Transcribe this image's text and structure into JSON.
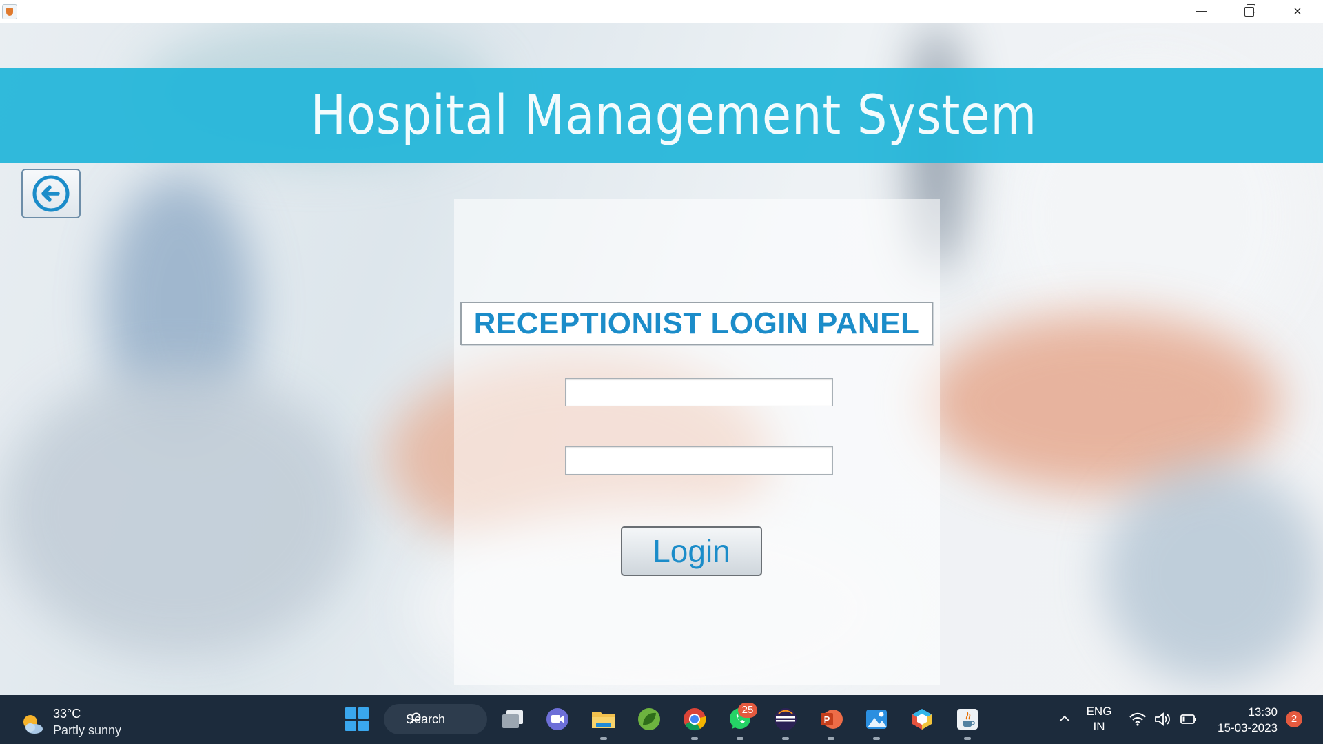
{
  "window": {
    "minimize_glyph": "minimize-icon",
    "maximize_glyph": "restore-icon",
    "close_glyph": "×"
  },
  "header": {
    "title": "Hospital Management System",
    "banner_color": "#26b6d9"
  },
  "login_panel": {
    "title": "RECEPTIONIST LOGIN PANEL",
    "username_value": "",
    "password_value": "",
    "login_label": "Login",
    "accent_color": "#1b8cc9"
  },
  "taskbar": {
    "weather": {
      "temp": "33°C",
      "desc": "Partly sunny",
      "icon": "partly-sunny-icon"
    },
    "search_label": "Search",
    "apps": [
      {
        "name": "start",
        "icon": "windows-start-icon"
      },
      {
        "name": "task-view",
        "icon": "task-view-icon"
      },
      {
        "name": "teams-chat",
        "icon": "video-chat-icon"
      },
      {
        "name": "file-explorer",
        "icon": "folder-icon"
      },
      {
        "name": "spring-tool",
        "icon": "spring-leaf-icon"
      },
      {
        "name": "chrome",
        "icon": "chrome-icon"
      },
      {
        "name": "whatsapp",
        "icon": "whatsapp-icon",
        "badge": "25"
      },
      {
        "name": "eclipse",
        "icon": "eclipse-icon"
      },
      {
        "name": "powerpoint",
        "icon": "powerpoint-icon"
      },
      {
        "name": "photos",
        "icon": "photos-icon"
      },
      {
        "name": "app-cube",
        "icon": "cube-icon"
      },
      {
        "name": "java",
        "icon": "java-icon"
      }
    ],
    "language": {
      "line1": "ENG",
      "line2": "IN"
    },
    "clock": {
      "time": "13:30",
      "date": "15-03-2023"
    },
    "notifications": "2"
  }
}
